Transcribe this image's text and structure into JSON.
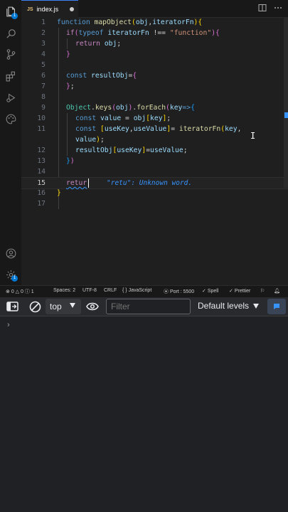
{
  "tab": {
    "lang_badge": "JS",
    "filename": "index.js"
  },
  "activity_badge": "1",
  "code_lines": [
    {
      "n": "1"
    },
    {
      "n": "2"
    },
    {
      "n": "3"
    },
    {
      "n": "4"
    },
    {
      "n": "5"
    },
    {
      "n": "6"
    },
    {
      "n": "7"
    },
    {
      "n": "8"
    },
    {
      "n": "9"
    },
    {
      "n": "10"
    },
    {
      "n": "11"
    },
    {
      "n": "12"
    },
    {
      "n": "13"
    },
    {
      "n": "14"
    },
    {
      "n": "15"
    },
    {
      "n": "16"
    },
    {
      "n": "17"
    }
  ],
  "code": {
    "l1": [
      "function",
      " ",
      "mapObject",
      "(",
      "obj",
      ",",
      "iteratorFn",
      ")",
      "{"
    ],
    "l2": [
      "if",
      "(",
      "typeof",
      " ",
      "iteratorFn",
      " !== ",
      "\"function\"",
      ")",
      "{"
    ],
    "l3": [
      "return",
      " ",
      "obj",
      ";"
    ],
    "l4": [
      "}"
    ],
    "l6": [
      "const",
      " ",
      "resultObj",
      "=",
      "{"
    ],
    "l7": [
      "}",
      ";"
    ],
    "l9": [
      "Object",
      ".",
      "keys",
      "(",
      "obj",
      ")",
      ".",
      "forEach",
      "(",
      "key",
      "=>",
      "{"
    ],
    "l10": [
      "const",
      " ",
      "value",
      " = ",
      "obj",
      "[",
      "key",
      "]",
      ";"
    ],
    "l11": [
      "const",
      " ",
      "[",
      "useKey",
      ",",
      "useValue",
      "]",
      "= ",
      "iteratorFn",
      "(",
      "key",
      ","
    ],
    "l11b": [
      "value",
      ")",
      ";"
    ],
    "l12": [
      "resultObj",
      "[",
      "useKey",
      "]",
      "=",
      "useValue",
      ";"
    ],
    "l13": [
      "}",
      ")"
    ],
    "l15": [
      "retur"
    ],
    "l16": [
      "}"
    ]
  },
  "spell_hint": "\"retu\": Unknown word.",
  "status": {
    "errors": "0",
    "warnings": "0",
    "info": "1",
    "spaces": "Spaces: 2",
    "encoding": "UTF-8",
    "eol": "CRLF",
    "language": "JavaScript",
    "port": "Port : 5500",
    "spell": "Spell",
    "prettier": "Prettier"
  },
  "devtools": {
    "context": "top",
    "filter_placeholder": "Filter",
    "levels": "Default levels",
    "prompt": "›"
  },
  "colors": {
    "accent": "#3794ff",
    "keyword": "#569cd6",
    "control": "#c586c0",
    "function": "#dcdcaa",
    "variable": "#9cdcfe",
    "string": "#ce9178"
  }
}
